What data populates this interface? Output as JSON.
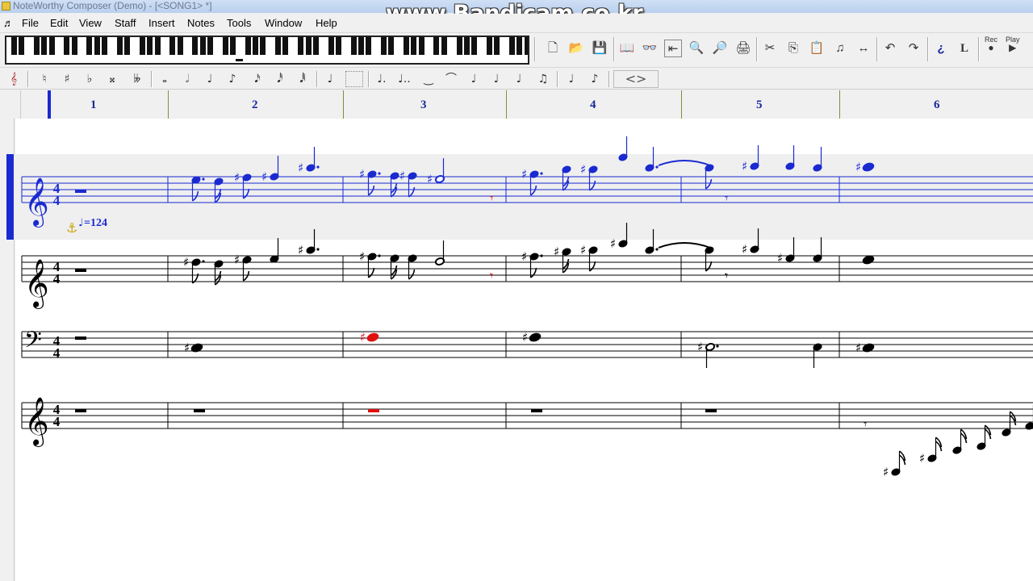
{
  "window": {
    "title": "NoteWorthy Composer (Demo) - [<SONG1> *]"
  },
  "watermark": {
    "text": "www.Bandicam.co.kr"
  },
  "menubar": {
    "items": [
      "File",
      "Edit",
      "View",
      "Staff",
      "Insert",
      "Notes",
      "Tools",
      "Window",
      "Help"
    ]
  },
  "toolbar": {
    "buttons": [
      "new-icon",
      "open-icon",
      "save-icon",
      "book-icon",
      "glasses-icon",
      "align-icon",
      "zoom-icon",
      "preview-icon",
      "print-icon",
      "cut-icon",
      "copy-icon",
      "paste-icon",
      "note-icon",
      "arrow-icon",
      "undo-icon",
      "redo-icon",
      "info-icon",
      "lyric-icon"
    ],
    "rec_label": "Rec",
    "play_label": "Play"
  },
  "ruler": {
    "bars": [
      "1",
      "2",
      "3",
      "4",
      "5",
      "6"
    ]
  },
  "score": {
    "tempo_text": "=124",
    "time_signature": {
      "numerator": "4",
      "denominator": "4"
    },
    "staves": [
      {
        "clef": "treble",
        "active": true
      },
      {
        "clef": "treble",
        "active": false
      },
      {
        "clef": "bass",
        "active": false
      },
      {
        "clef": "treble",
        "active": false
      }
    ]
  },
  "colors": {
    "active_note": "#1a2ad0",
    "error_note": "#e01010",
    "cursor": "#1a2ad0"
  }
}
